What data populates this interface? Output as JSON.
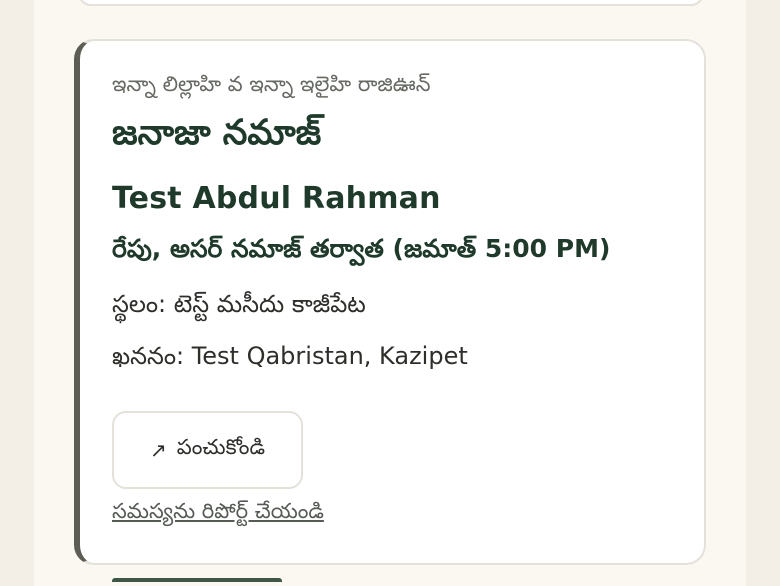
{
  "card": {
    "subtitle": "ఇన్నా లిల్లాహి వ ఇన్నా ఇలైహి రాజిఊన్",
    "title": "జనాజా నమాజ్",
    "name": "Test Abdul Rahman",
    "time": "రేపు, అసర్ నమాజ్ తర్వాత (జమాత్ 5:00 PM)",
    "place": "స్థలం: టెస్ట్ మసీదు కాజీపేట",
    "burial": "ఖననం: Test Qabristan, Kazipet",
    "share_icon": "↗",
    "share_label": "పంచుకోండి",
    "report_label": "సమస్యను రిపోర్ట్ చేయండి"
  },
  "colors": {
    "page_bg": "#f4efe6",
    "card_border": "#e4e1da",
    "accent_border": "#5d5d55",
    "heading": "#1f3a2a"
  }
}
